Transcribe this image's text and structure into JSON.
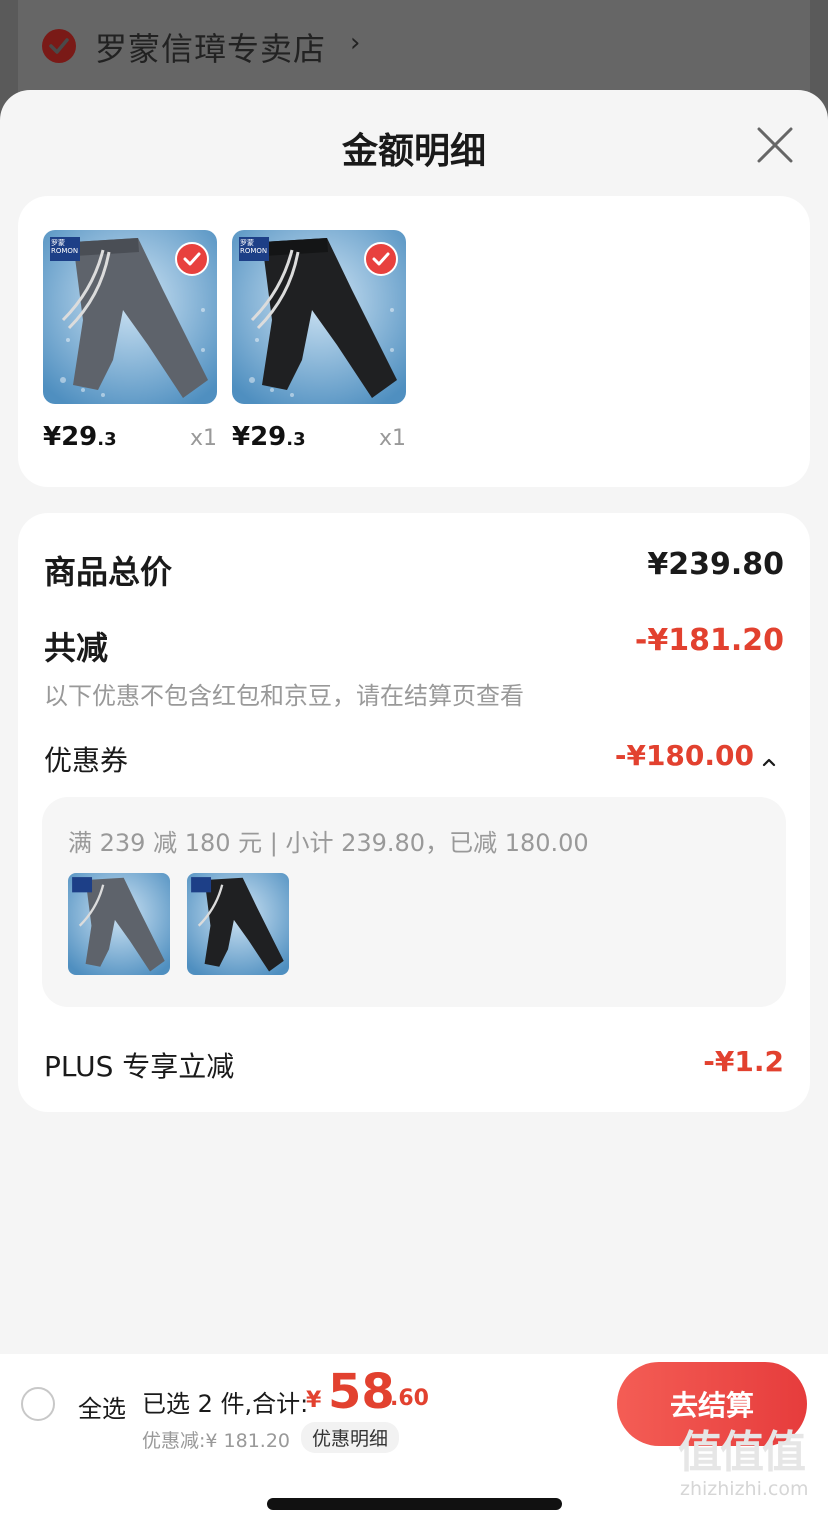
{
  "store": {
    "name": "罗蒙信璋专卖店",
    "chevron": "›"
  },
  "sheet": {
    "title": "金额明细"
  },
  "products": [
    {
      "price_int": "¥29",
      "price_dec": ".3",
      "qty": "x1",
      "color": "gray"
    },
    {
      "price_int": "¥29",
      "price_dec": ".3",
      "qty": "x1",
      "color": "black"
    }
  ],
  "brand_tag": {
    "cn": "罗蒙",
    "en": "ROMON"
  },
  "detail": {
    "total_label": "商品总价",
    "total_value": "¥239.80",
    "discount_label": "共减",
    "discount_value": "-¥181.20",
    "discount_note": "以下优惠不包含红包和京豆，请在结算页查看",
    "coupon_label": "优惠券",
    "coupon_value": "-¥180.00",
    "coupon_rule": "满 239 减 180 元 | 小计 239.80，已减 180.00",
    "plus_label": "PLUS 专享立减",
    "plus_value": "-¥1.2"
  },
  "bottom": {
    "select_all": "全选",
    "selected_count": "已选 2 件,合计:",
    "currency": "¥",
    "total_int": "58",
    "total_dec": ".60",
    "discount_line": "优惠减:¥ 181.20",
    "discount_tag": "优惠明细",
    "checkout": "去结算"
  },
  "watermark": {
    "logo": "值值值",
    "url": "zhizhizhi.com"
  },
  "colors": {
    "accent_red": "#e2412f",
    "button_red": "#e63c3c",
    "sheet_bg": "#f5f5f5"
  }
}
